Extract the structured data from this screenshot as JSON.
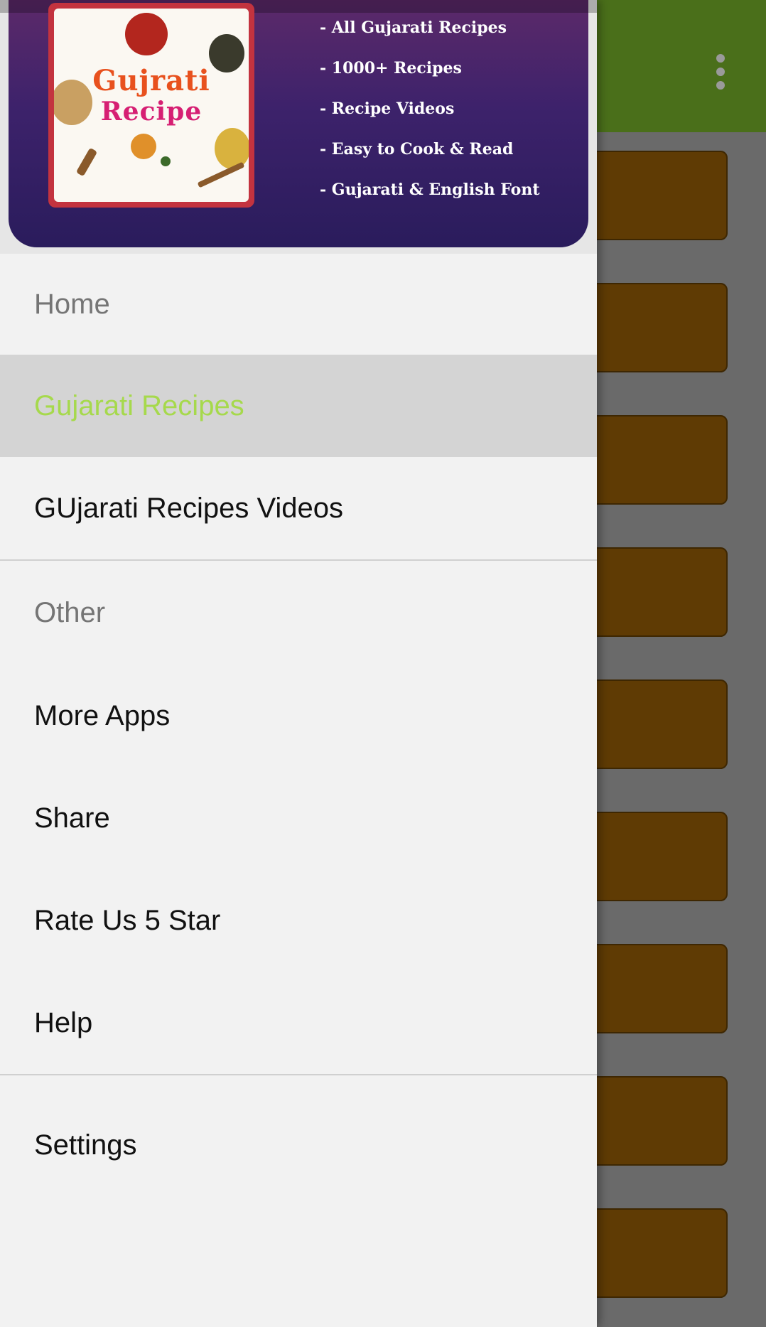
{
  "app": {
    "toolbar_color": "#4a6f1a",
    "button_color": "#5f3b04",
    "overflow_icon": "more-vert-icon"
  },
  "drawer": {
    "banner": {
      "logo": {
        "line1": "Gujrati",
        "line2": "Recipe"
      },
      "features": [
        "- All Gujarati Recipes",
        "- 1000+ Recipes",
        "- Recipe Videos",
        "- Easy to Cook & Read",
        "- Gujarati & English Font"
      ]
    },
    "home_header": "Home",
    "items": [
      {
        "label": "Gujarati Recipes",
        "active": true
      },
      {
        "label": "GUjarati Recipes Videos",
        "active": false
      }
    ],
    "other_header": "Other",
    "other_items": [
      {
        "label": "More Apps"
      },
      {
        "label": "Share"
      },
      {
        "label": "Rate Us 5 Star"
      },
      {
        "label": "Help"
      }
    ],
    "settings_label": "Settings",
    "active_color": "#a6d94c"
  }
}
